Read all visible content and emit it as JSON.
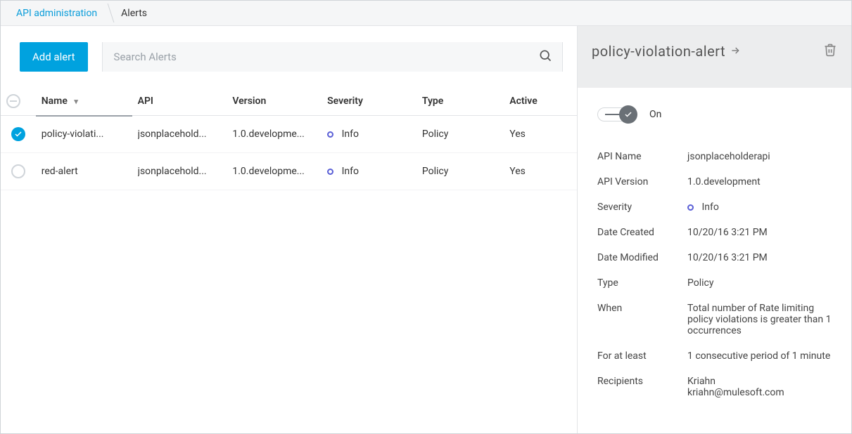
{
  "breadcrumb": {
    "root": "API administration",
    "current": "Alerts"
  },
  "toolbar": {
    "add_label": "Add alert",
    "search_placeholder": "Search Alerts"
  },
  "table": {
    "headers": {
      "name": "Name",
      "api": "API",
      "version": "Version",
      "severity": "Severity",
      "type": "Type",
      "active": "Active"
    },
    "rows": [
      {
        "selected": true,
        "name": "policy-violati...",
        "api": "jsonplacehold...",
        "version": "1.0.developme...",
        "severity": "Info",
        "type": "Policy",
        "active": "Yes"
      },
      {
        "selected": false,
        "name": "red-alert",
        "api": "jsonplacehold...",
        "version": "1.0.developme...",
        "severity": "Info",
        "type": "Policy",
        "active": "Yes"
      }
    ]
  },
  "panel": {
    "title": "policy-violation-alert",
    "toggle_state": "On",
    "fields": {
      "api_name": {
        "label": "API Name",
        "value": "jsonplaceholderapi"
      },
      "api_version": {
        "label": "API Version",
        "value": "1.0.development"
      },
      "severity": {
        "label": "Severity",
        "value": "Info"
      },
      "date_created": {
        "label": "Date Created",
        "value": "10/20/16 3:21 PM"
      },
      "date_modified": {
        "label": "Date Modified",
        "value": "10/20/16 3:21 PM"
      },
      "type": {
        "label": "Type",
        "value": "Policy"
      },
      "when": {
        "label": "When",
        "value": "Total number of Rate limiting policy violations is greater than 1 occurrences"
      },
      "for_at_least": {
        "label": "For at least",
        "value": "1 consecutive period of 1 minute"
      },
      "recipients": {
        "label": "Recipients",
        "value": "Kriahn\nkriahn@mulesoft.com"
      }
    }
  }
}
